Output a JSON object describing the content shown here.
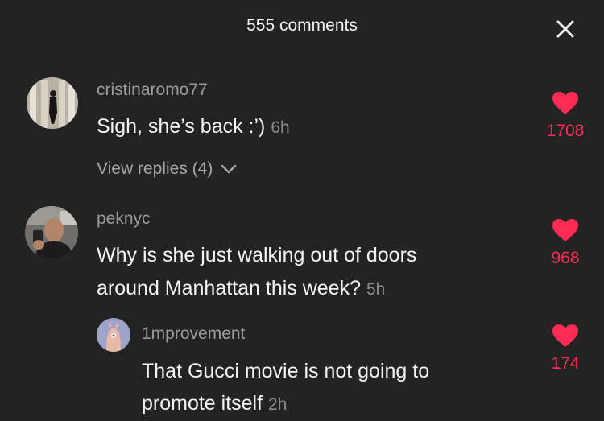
{
  "header": {
    "title": "555 comments",
    "close_icon": "close-icon"
  },
  "colors": {
    "background": "#232323",
    "like": "#fe2c55",
    "muted": "#9b9b9b"
  },
  "comments": [
    {
      "username": "cristinaromo77",
      "text": "Sigh, she’s back :’)",
      "time": "6h",
      "likes": "1708",
      "view_replies": "View replies (4)"
    },
    {
      "username": "peknyc",
      "text_line1": "Why is she just walking out of doors",
      "text_line2": "around Manhattan this week?",
      "time": "5h",
      "likes": "968"
    },
    {
      "username": "1mprovement",
      "text_line1": "That Gucci movie is not going to",
      "text_line2": "promote itself",
      "time": "2h",
      "likes": "174"
    }
  ]
}
